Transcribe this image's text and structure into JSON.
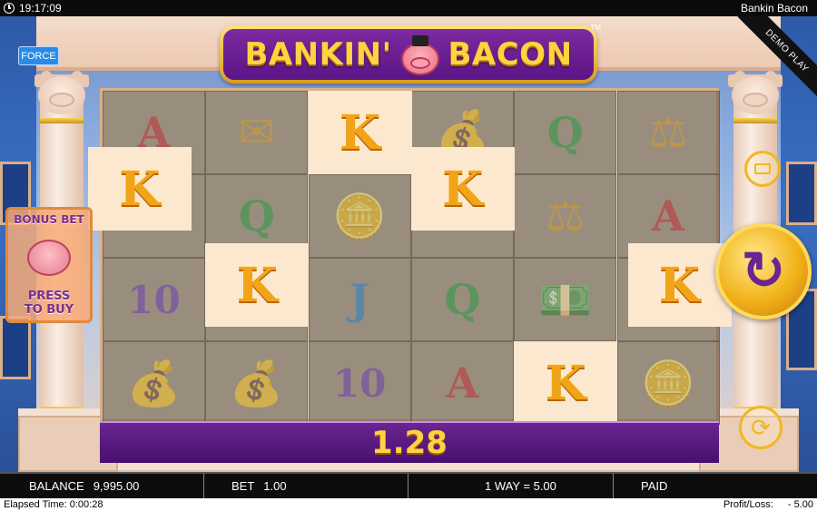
{
  "status_bar": {
    "time": "19:17:09",
    "game_name": "Bankin Bacon"
  },
  "title": {
    "word1": "BANKIN'",
    "word2": "BACON",
    "trademark": "TM"
  },
  "buttons": {
    "force": "FORCE",
    "demo_ribbon": "DEMO PLAY"
  },
  "bonus_panel": {
    "title": "BONUS BET",
    "press_line1": "PRESS",
    "press_line2": "TO BUY"
  },
  "reels": {
    "columns": [
      [
        "A",
        "K",
        "10",
        "chest"
      ],
      [
        "cheque",
        "Q",
        "K",
        "chest"
      ],
      [
        "K",
        "coin",
        "J",
        "10"
      ],
      [
        "chest",
        "K",
        "Q",
        "A"
      ],
      [
        "Q",
        "scales",
        "cash",
        "K"
      ],
      [
        "scales",
        "A",
        "K",
        "coin"
      ]
    ],
    "winning_symbol": "K",
    "k_label": "K"
  },
  "win": {
    "amount": "1.28"
  },
  "icons": {
    "spin": "spin-arrow-icon",
    "bet": "bet-cash-icon",
    "autoplay": "autoplay-icon",
    "clock": "clock-icon"
  },
  "colors": {
    "accent_purple": "#6a2591",
    "gold": "#f2b219",
    "force_blue": "#2a8ae8"
  },
  "info_bar": {
    "balance_label": "BALANCE",
    "balance_value": "9,995.00",
    "bet_label": "BET",
    "bet_value": "1.00",
    "ways": "1 WAY = 5.00",
    "paid_label": "PAID"
  },
  "footer": {
    "elapsed": "Elapsed Time: 0:00:28",
    "profit_label": "Profit/Loss:",
    "profit_value": "- 5.00"
  }
}
